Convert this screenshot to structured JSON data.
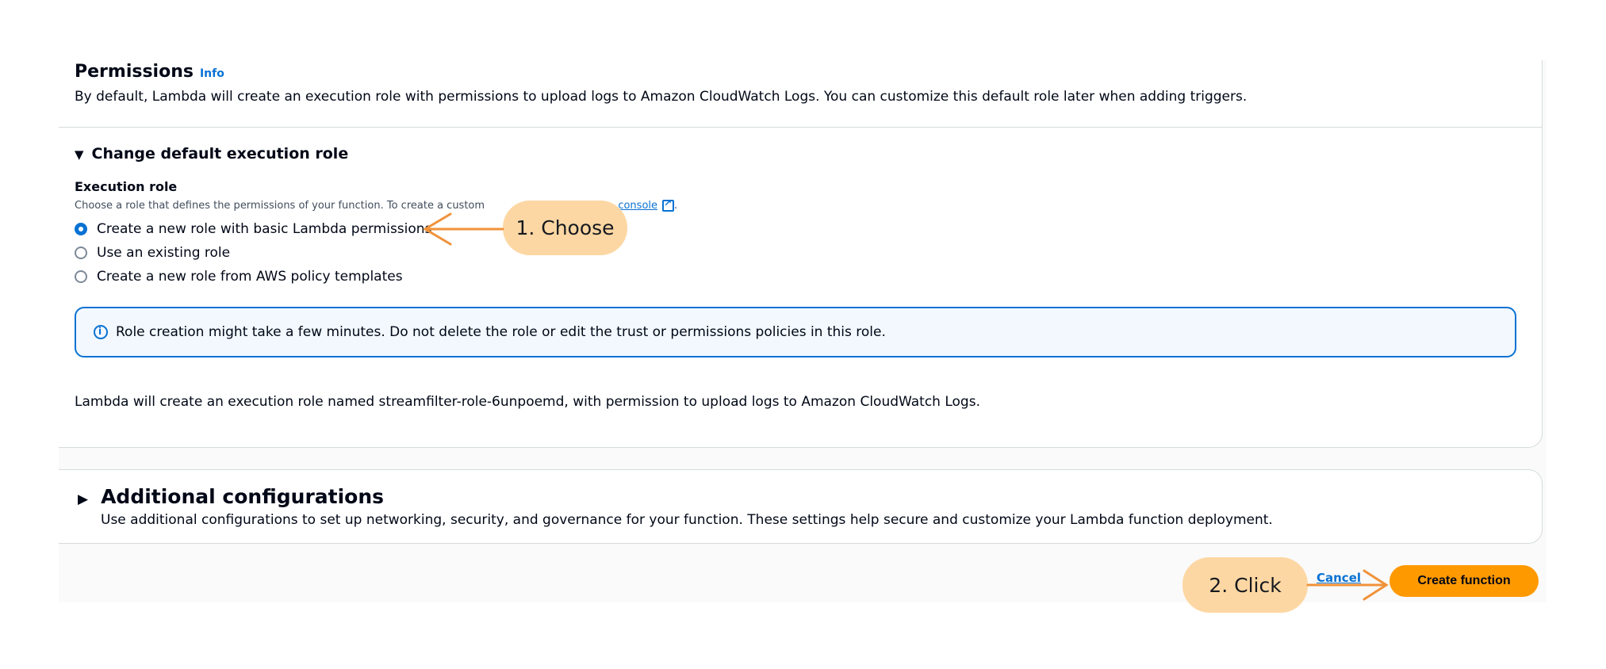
{
  "permissions": {
    "title": "Permissions",
    "info_link": "Info",
    "description": "By default, Lambda will create an execution role with permissions to upload logs to Amazon CloudWatch Logs. You can customize this default role later when adding triggers."
  },
  "execution_role_section": {
    "expander_label": "Change default execution role",
    "field_label": "Execution role",
    "field_description_visible": "Choose a role that defines the permissions of your function. To create a custom",
    "field_description_link_fragment": "console",
    "options": [
      {
        "label": "Create a new role with basic Lambda permissions",
        "selected": true
      },
      {
        "label": "Use an existing role",
        "selected": false
      },
      {
        "label": "Create a new role from AWS policy templates",
        "selected": false
      }
    ],
    "alert_text": "Role creation might take a few minutes. Do not delete the role or edit the trust or permissions policies in this role.",
    "role_note": "Lambda will create an execution role named streamfilter-role-6unpoemd, with permission to upload logs to Amazon CloudWatch Logs."
  },
  "additional_configurations": {
    "title": "Additional configurations",
    "description": "Use additional configurations to set up networking, security, and governance for your function. These settings help secure and customize your Lambda function deployment."
  },
  "footer": {
    "cancel_label": "Cancel",
    "create_label": "Create function"
  },
  "annotations": {
    "step1": "1. Choose",
    "step2": "2. Click"
  },
  "colors": {
    "accent_blue": "#0972d3",
    "primary_orange": "#ff9900",
    "callout_bg": "#fdd7a3",
    "arrow_orange": "#f0923a"
  },
  "icons": [
    "caret-down-icon",
    "caret-right-icon",
    "external-link-icon",
    "info-circle-icon",
    "radio-icon"
  ]
}
